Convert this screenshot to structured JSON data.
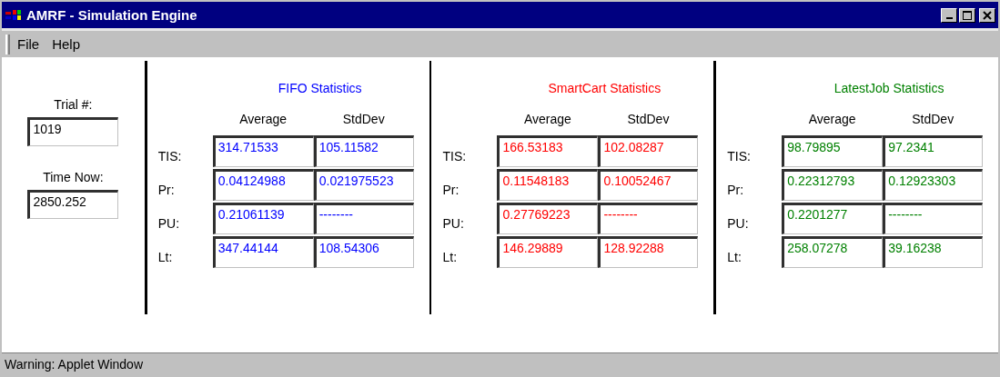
{
  "window": {
    "title": "AMRF - Simulation Engine"
  },
  "menu": [
    "File",
    "Help"
  ],
  "trial": {
    "label": "Trial #:",
    "value": "1019"
  },
  "time_now": {
    "label": "Time Now:",
    "value": "2850.252"
  },
  "panels": [
    {
      "title": "FIFO Statistics",
      "color": "#0000ff",
      "columns": [
        "Average",
        "StdDev"
      ],
      "rows": [
        {
          "label": "TIS:",
          "values": [
            "314.71533",
            "105.11582"
          ]
        },
        {
          "label": "Pr:",
          "values": [
            "0.04124988",
            "0.021975523"
          ]
        },
        {
          "label": "PU:",
          "values": [
            "0.21061139",
            "--------"
          ]
        },
        {
          "label": "Lt:",
          "values": [
            "347.44144",
            "108.54306"
          ]
        }
      ]
    },
    {
      "title": "SmartCart Statistics",
      "color": "#ff0000",
      "columns": [
        "Average",
        "StdDev"
      ],
      "rows": [
        {
          "label": "TIS:",
          "values": [
            "166.53183",
            "102.08287"
          ]
        },
        {
          "label": "Pr:",
          "values": [
            "0.11548183",
            "0.10052467"
          ]
        },
        {
          "label": "PU:",
          "values": [
            "0.27769223",
            "--------"
          ]
        },
        {
          "label": "Lt:",
          "values": [
            "146.29889",
            "128.92288"
          ]
        }
      ]
    },
    {
      "title": "LatestJob Statistics",
      "color": "#008000",
      "columns": [
        "Average",
        "StdDev"
      ],
      "rows": [
        {
          "label": "TIS:",
          "values": [
            "98.79895",
            "97.2341"
          ]
        },
        {
          "label": "Pr:",
          "values": [
            "0.22312793",
            "0.12923303"
          ]
        },
        {
          "label": "PU:",
          "values": [
            "0.2201277",
            "--------"
          ]
        },
        {
          "label": "Lt:",
          "values": [
            "258.07278",
            "39.16238"
          ]
        }
      ]
    }
  ],
  "status_bar": "Warning: Applet Window"
}
